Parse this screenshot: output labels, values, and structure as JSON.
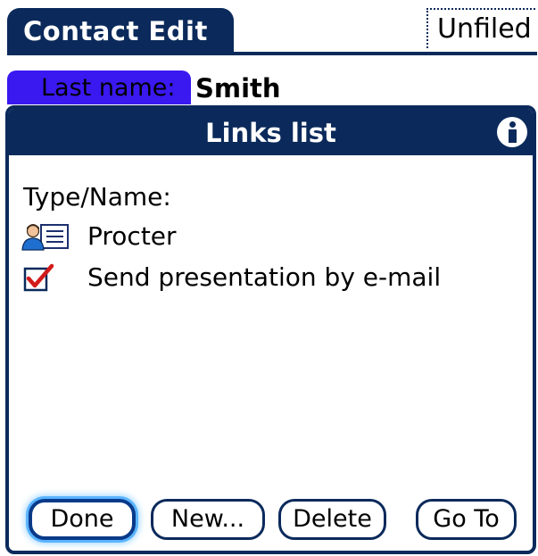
{
  "app": {
    "title": "Contact Edit",
    "category": "Unfiled"
  },
  "field": {
    "label": "Last name:",
    "value": "Smith"
  },
  "dialog": {
    "title": "Links list",
    "info_icon": "info-icon",
    "column_header": "Type/Name:",
    "links": [
      {
        "icon": "contact-card-icon",
        "name": "Procter"
      },
      {
        "icon": "task-checkbox-icon",
        "name": "Send presentation by e-mail"
      }
    ],
    "buttons": {
      "done": "Done",
      "new": "New...",
      "delete": "Delete",
      "goto": "Go To"
    }
  },
  "colors": {
    "title_bar": "#0b2a5b",
    "label_highlight": "#3a18f0",
    "focus_glow": "#5ab4ff"
  }
}
